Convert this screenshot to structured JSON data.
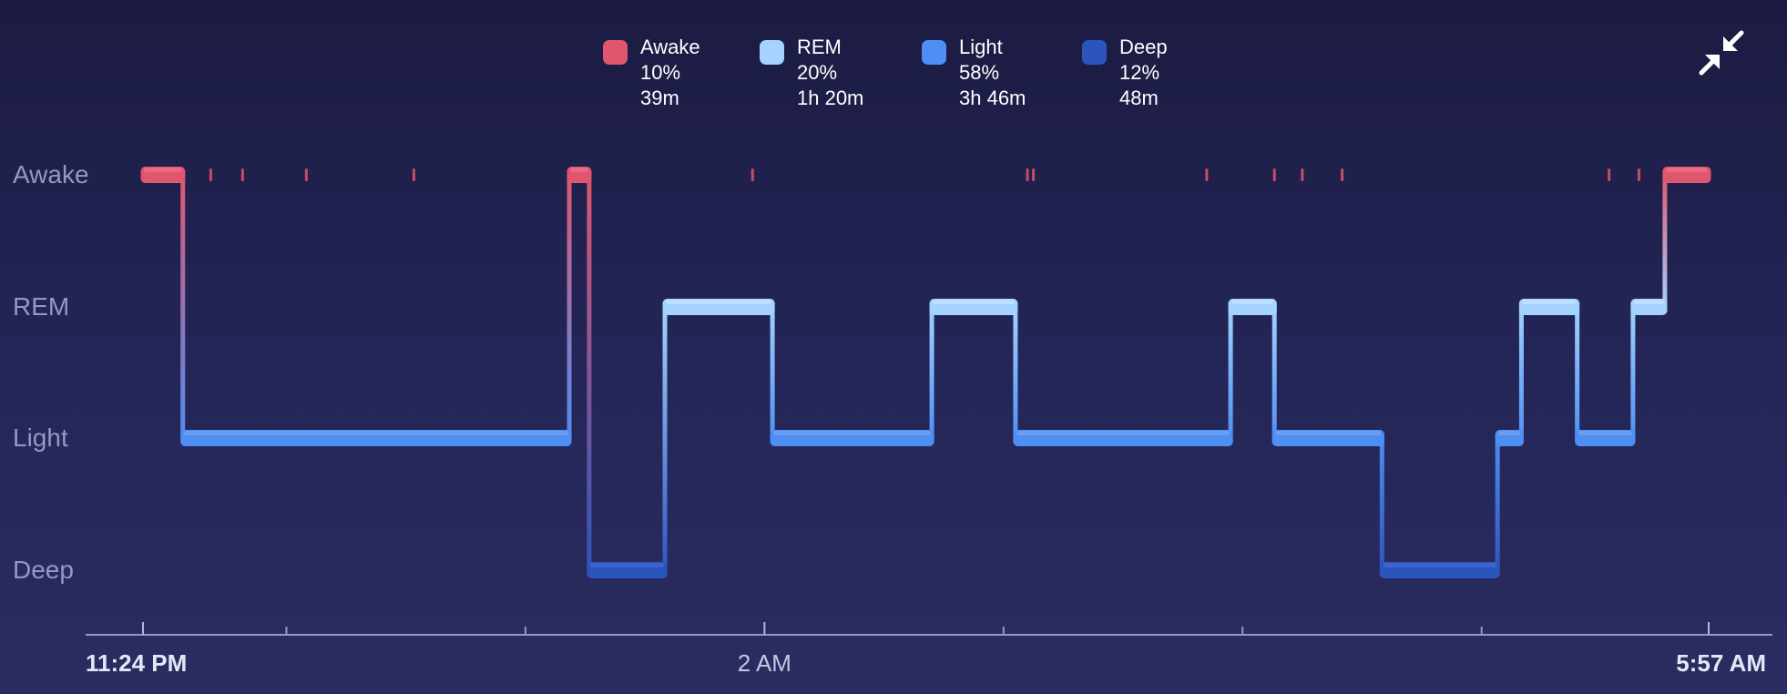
{
  "legend": [
    {
      "name": "Awake",
      "percent": "10%",
      "duration": "39m",
      "color": "#e0566f"
    },
    {
      "name": "REM",
      "percent": "20%",
      "duration": "1h 20m",
      "color": "#a5d3ff"
    },
    {
      "name": "Light",
      "percent": "58%",
      "duration": "3h 46m",
      "color": "#4f8ef2"
    },
    {
      "name": "Deep",
      "percent": "12%",
      "duration": "48m",
      "color": "#2b55bd"
    }
  ],
  "toolbar": {
    "collapse_icon": "collapse-arrows-icon"
  },
  "chart_data": {
    "type": "step",
    "x_unit": "minutes after 11:24 PM",
    "x_range": [
      0,
      393
    ],
    "x_tick_labels": [
      {
        "minute": 0,
        "label": "11:24 PM"
      },
      {
        "minute": 156,
        "label": "2 AM"
      },
      {
        "minute": 393,
        "label": "5:57 AM"
      }
    ],
    "x_minor_ticks": [
      36,
      96,
      216,
      276,
      336
    ],
    "y_categories": [
      "Awake",
      "REM",
      "Light",
      "Deep"
    ],
    "stages": [
      {
        "stage": "Awake",
        "start": 0,
        "end": 10
      },
      {
        "stage": "Light",
        "start": 10,
        "end": 107
      },
      {
        "stage": "Awake",
        "start": 107,
        "end": 112
      },
      {
        "stage": "Deep",
        "start": 112,
        "end": 131
      },
      {
        "stage": "REM",
        "start": 131,
        "end": 158
      },
      {
        "stage": "Light",
        "start": 158,
        "end": 198
      },
      {
        "stage": "REM",
        "start": 198,
        "end": 219
      },
      {
        "stage": "Light",
        "start": 219,
        "end": 273
      },
      {
        "stage": "REM",
        "start": 273,
        "end": 284
      },
      {
        "stage": "Light",
        "start": 284,
        "end": 311
      },
      {
        "stage": "Deep",
        "start": 311,
        "end": 340
      },
      {
        "stage": "Light",
        "start": 340,
        "end": 346
      },
      {
        "stage": "REM",
        "start": 346,
        "end": 360
      },
      {
        "stage": "Light",
        "start": 360,
        "end": 374
      },
      {
        "stage": "REM",
        "start": 374,
        "end": 382
      },
      {
        "stage": "Awake",
        "start": 382,
        "end": 393
      }
    ],
    "brief_awakenings": [
      17,
      25,
      41,
      68,
      153,
      222,
      223.5,
      267,
      284,
      291,
      301,
      368,
      375.5
    ]
  }
}
